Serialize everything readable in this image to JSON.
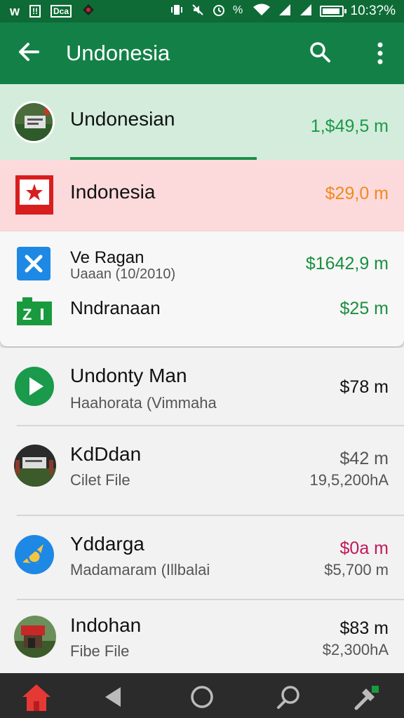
{
  "status_bar": {
    "left_icons": [
      "w-icon",
      "sim-icon",
      "gallery-icon",
      "app-icon"
    ],
    "left_glyphs": [
      "w",
      "!!",
      "Dca"
    ],
    "time": "10:3?%",
    "icons": [
      "vibrate-icon",
      "no-sound-icon",
      "alarm-icon",
      "data-icon",
      "wifi-icon",
      "signal-icon",
      "signal-icon",
      "battery-icon"
    ]
  },
  "app_bar": {
    "title": "Undonesia",
    "icons": [
      "back-arrow-icon",
      "search-icon",
      "more-vert-icon"
    ]
  },
  "rows": [
    {
      "title": "Undonesian",
      "amount": "1,$49,5 m",
      "amount_color": "#1a9a4a",
      "icon": "photo-avatar"
    },
    {
      "title": "Indonesia",
      "amount": "$29,0 m",
      "amount_color": "#f08a1c",
      "icon": "flag-icon"
    },
    {
      "title": "Ve Ragan",
      "subtitle": "Uaaan (10/2010)",
      "amount": "$1642,9 m",
      "amount_color": "#1a8f3e",
      "icon": "close-tile-icon"
    },
    {
      "title": "Nndranaan",
      "amount": "$25 m",
      "amount_color": "#1a8f3e",
      "icon": "z-tile-icon"
    },
    {
      "title": "Undonty Man",
      "subtitle": "Haahorata (Vimmaha",
      "amount": "$78 m",
      "amount_color": "#111111",
      "icon": "play-icon"
    },
    {
      "title": "KdDdan",
      "subtitle": "Cilet File",
      "amount": "$42 m",
      "amount2": "19,5,200hA",
      "amount_color": "#555555",
      "icon": "photo-avatar"
    },
    {
      "title": "Yddarga",
      "subtitle": "Madamaram (Illbalai",
      "amount": "$0a m",
      "amount2": "$5,700 m",
      "amount_color": "#c2185b",
      "icon": "compass-icon"
    },
    {
      "title": "Indohan",
      "subtitle": "Fibe File",
      "amount": "$83 m",
      "amount2": "$2,300hA",
      "amount_color": "#111111",
      "icon": "photo-avatar"
    }
  ],
  "nav_bar": {
    "icons": [
      "home-icon",
      "back-triangle-icon",
      "home-circle-icon",
      "search-nav-icon",
      "tool-icon"
    ]
  },
  "colors": {
    "primary": "#138147",
    "status_bar": "#0e6b36",
    "selected_row": "#d4ecdc",
    "highlight_row": "#fcdadc"
  }
}
